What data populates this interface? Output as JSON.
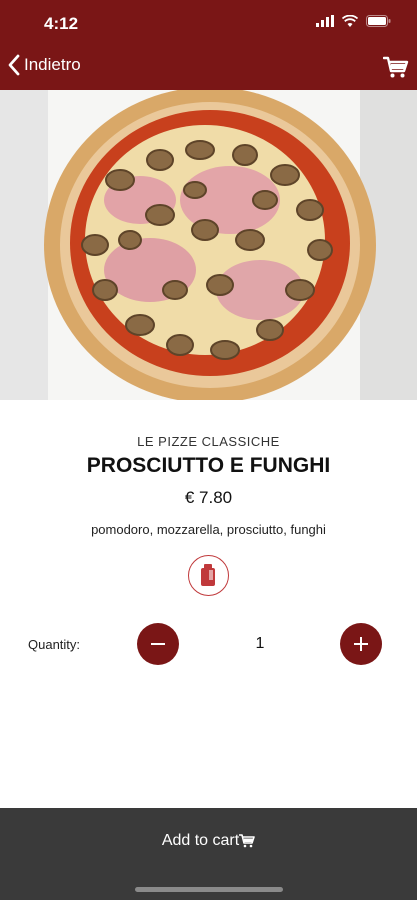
{
  "status_bar": {
    "time": "4:12"
  },
  "nav": {
    "back_label": "Indietro"
  },
  "product": {
    "category": "LE PIZZE CLASSICHE",
    "name": "PROSCIUTTO E FUNGHI",
    "price": "€ 7.80",
    "ingredients": "pomodoro, mozzarella, prosciutto, funghi"
  },
  "quantity": {
    "label": "Quantity:",
    "value": "1"
  },
  "footer": {
    "add_to_cart_label": "Add to cart"
  },
  "colors": {
    "brand": "#7a1616",
    "footer": "#3a3a3a",
    "accent": "#c0393b"
  },
  "icons": [
    "chevron-left-icon",
    "cart-icon",
    "drink-icon",
    "minus-icon",
    "plus-icon"
  ]
}
